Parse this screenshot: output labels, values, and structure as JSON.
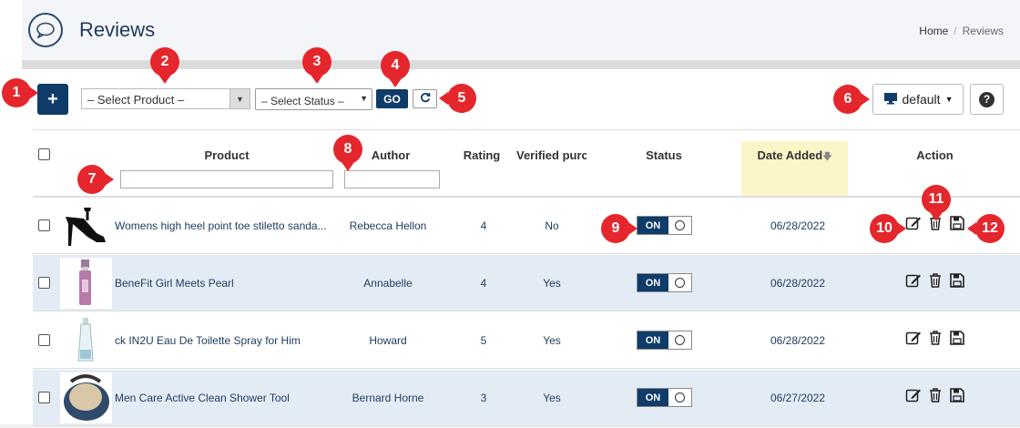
{
  "header": {
    "title": "Reviews",
    "breadcrumb": [
      {
        "label": "Home"
      },
      {
        "label": "Reviews"
      }
    ]
  },
  "toolbar": {
    "add_label": "+",
    "product_select": "– Select Product –",
    "status_select": "– Select Status –",
    "go_label": "GO",
    "view_label": "default",
    "help_label": "?"
  },
  "columns": {
    "product": "Product",
    "author": "Author",
    "rating": "Rating",
    "verified": "Verified purc",
    "status": "Status",
    "date_added": "Date Added",
    "action": "Action"
  },
  "rows": [
    {
      "product": "Womens high heel point toe stiletto sanda...",
      "author": "Rebecca Hellon",
      "rating": "4",
      "verified": "No",
      "status": "ON",
      "date": "06/28/2022"
    },
    {
      "product": "BeneFit Girl Meets Pearl",
      "author": "Annabelle",
      "rating": "4",
      "verified": "Yes",
      "status": "ON",
      "date": "06/28/2022"
    },
    {
      "product": "ck IN2U Eau De Toilette Spray for Him",
      "author": "Howard",
      "rating": "5",
      "verified": "Yes",
      "status": "ON",
      "date": "06/28/2022"
    },
    {
      "product": "Men Care Active Clean Shower Tool",
      "author": "Bernard Horne",
      "rating": "3",
      "verified": "Yes",
      "status": "ON",
      "date": "06/27/2022"
    }
  ],
  "callouts": [
    "1",
    "2",
    "3",
    "4",
    "5",
    "6",
    "7",
    "8",
    "9",
    "10",
    "11",
    "12"
  ],
  "colors": {
    "primary": "#0f3c68",
    "callout": "#e5262c",
    "row_alt": "#e3ecf5",
    "sort_highlight": "#fcf5c8"
  },
  "icons": [
    "chat-icon",
    "plus-icon",
    "refresh-icon",
    "monitor-icon",
    "help-icon",
    "sort-down-icon",
    "edit-icon",
    "trash-icon",
    "save-icon"
  ]
}
